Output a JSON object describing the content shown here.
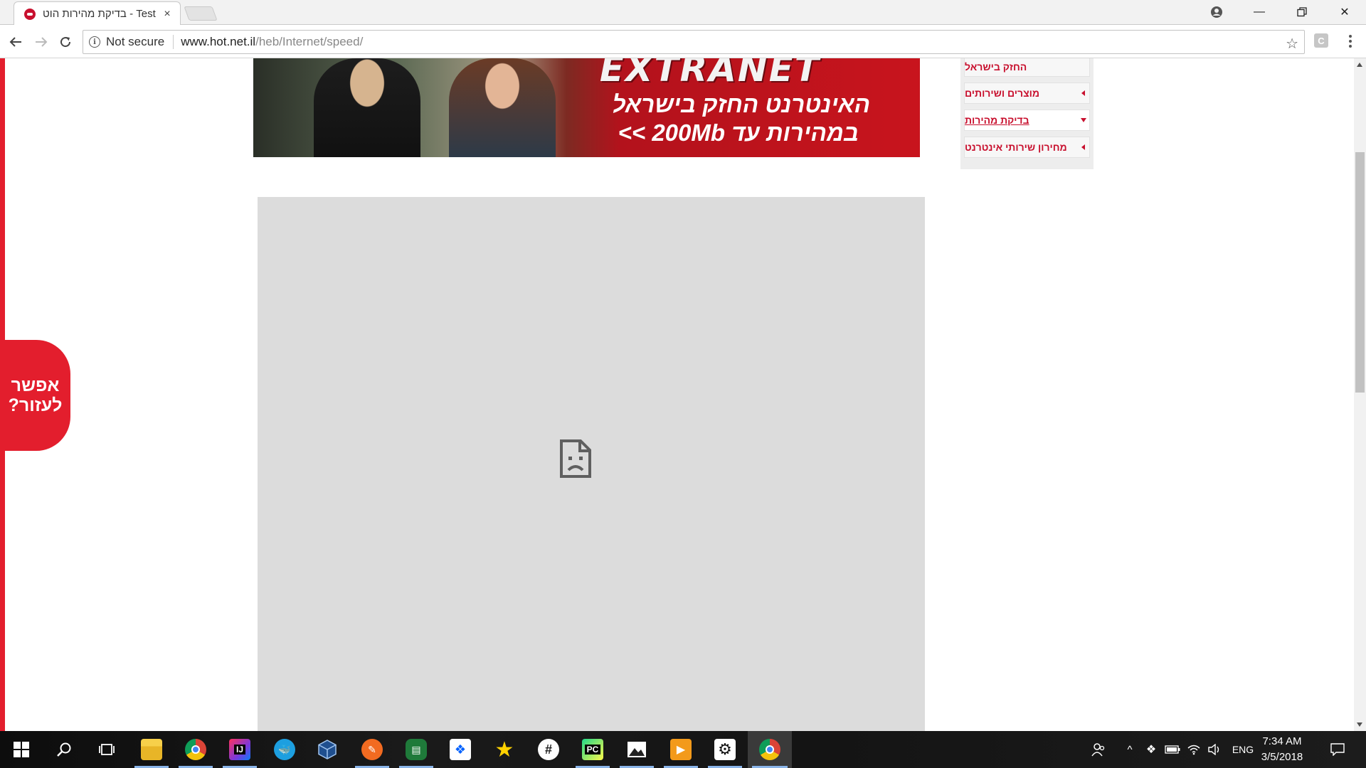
{
  "browser": {
    "tab": {
      "title": "בדיקת מהירות הוט - Test",
      "close_glyph": "×",
      "favicon": "hot-logo-icon"
    },
    "window_controls": {
      "account": "account-icon",
      "minimize": "—",
      "restore": "restore-icon",
      "close": "✕"
    },
    "toolbar": {
      "back": "back-arrow-icon",
      "forward": "forward-arrow-icon",
      "reload": "reload-icon",
      "security_label": "Not secure",
      "url_host": "www.hot.net.il",
      "url_path": "/heb/Internet/speed/",
      "bookmark": "☆",
      "extension_letter": "C",
      "menu": "more-vert-icon"
    }
  },
  "page": {
    "accent_color": "#e31e2d",
    "banner": {
      "brand": "EXTRANET",
      "headline_line1": "האינטרנט החזק בישראל",
      "headline_line2": "במהירות עד 200Mb >>"
    },
    "side_menu": {
      "items": [
        {
          "label": "החזק בישראל",
          "arrow": "none"
        },
        {
          "label": "מוצרים ושירותים",
          "arrow": "left"
        },
        {
          "label": "בדיקת מהירות",
          "arrow": "down",
          "active": true
        },
        {
          "label": "מחירון שירותי אינטרנט",
          "arrow": "left"
        }
      ]
    },
    "embedded_frame": {
      "state": "failed-to-load",
      "icon": "sad-file-icon"
    },
    "help_bubble": {
      "line1": "אפשר",
      "line2": "לעזור?"
    }
  },
  "taskbar": {
    "apps": [
      {
        "name": "start",
        "icon": "windows-logo-icon"
      },
      {
        "name": "search",
        "icon": "search-icon"
      },
      {
        "name": "task-view",
        "icon": "task-view-icon"
      },
      {
        "name": "file-explorer",
        "icon": "folder-icon",
        "open": true
      },
      {
        "name": "chrome",
        "icon": "chrome-icon",
        "open": true
      },
      {
        "name": "intellij",
        "icon": "intellij-icon",
        "label": "IJ",
        "open": true
      },
      {
        "name": "docker",
        "icon": "docker-icon"
      },
      {
        "name": "virtualbox",
        "icon": "virtualbox-icon"
      },
      {
        "name": "app-orange",
        "icon": "pencil-app-icon",
        "open": true
      },
      {
        "name": "app-green",
        "icon": "green-app-icon",
        "open": true
      },
      {
        "name": "dropbox",
        "icon": "dropbox-icon"
      },
      {
        "name": "app-star",
        "icon": "star-icon"
      },
      {
        "name": "slack",
        "icon": "slack-icon"
      },
      {
        "name": "pycharm",
        "icon": "pycharm-icon",
        "label": "PC",
        "open": true
      },
      {
        "name": "photos",
        "icon": "photos-icon",
        "open": true
      },
      {
        "name": "media-player",
        "icon": "media-player-icon",
        "open": true
      },
      {
        "name": "app-gear",
        "icon": "settings-app-icon",
        "open": true
      },
      {
        "name": "chrome-active",
        "icon": "chrome-icon",
        "open": true,
        "active": true
      }
    ],
    "tray": {
      "people": "people-icon",
      "show_hidden": "^",
      "dropbox": "dropbox-icon",
      "battery": "battery-icon",
      "wifi": "wifi-icon",
      "volume": "volume-icon",
      "language": "ENG",
      "time": "7:34 AM",
      "date": "3/5/2018",
      "notifications": "notification-icon"
    }
  }
}
